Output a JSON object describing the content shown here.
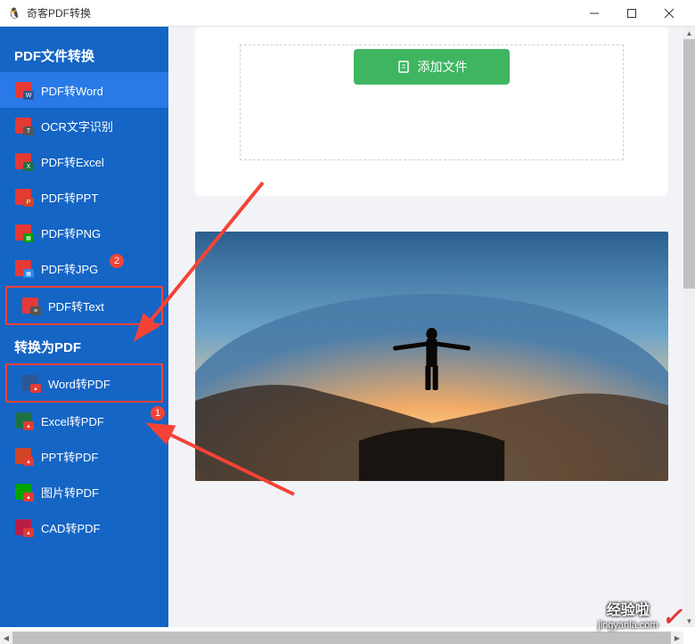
{
  "window": {
    "title": "奇客PDF转换"
  },
  "sidebar": {
    "section1": {
      "title": "PDF文件转换"
    },
    "items1": [
      {
        "label": "PDF转Word"
      },
      {
        "label": "OCR文字识别"
      },
      {
        "label": "PDF转Excel"
      },
      {
        "label": "PDF转PPT"
      },
      {
        "label": "PDF转PNG"
      },
      {
        "label": "PDF转JPG"
      },
      {
        "label": "PDF转Text"
      }
    ],
    "section2": {
      "title": "转换为PDF"
    },
    "items2": [
      {
        "label": "Word转PDF"
      },
      {
        "label": "Excel转PDF"
      },
      {
        "label": "PPT转PDF"
      },
      {
        "label": "图片转PDF"
      },
      {
        "label": "CAD转PDF"
      }
    ]
  },
  "annotations": {
    "badge_jpg": "2",
    "badge_excel": "1"
  },
  "content": {
    "add_button": "添加文件"
  },
  "watermark": {
    "line1": "经验啦",
    "line2": "jingyanla.com"
  }
}
